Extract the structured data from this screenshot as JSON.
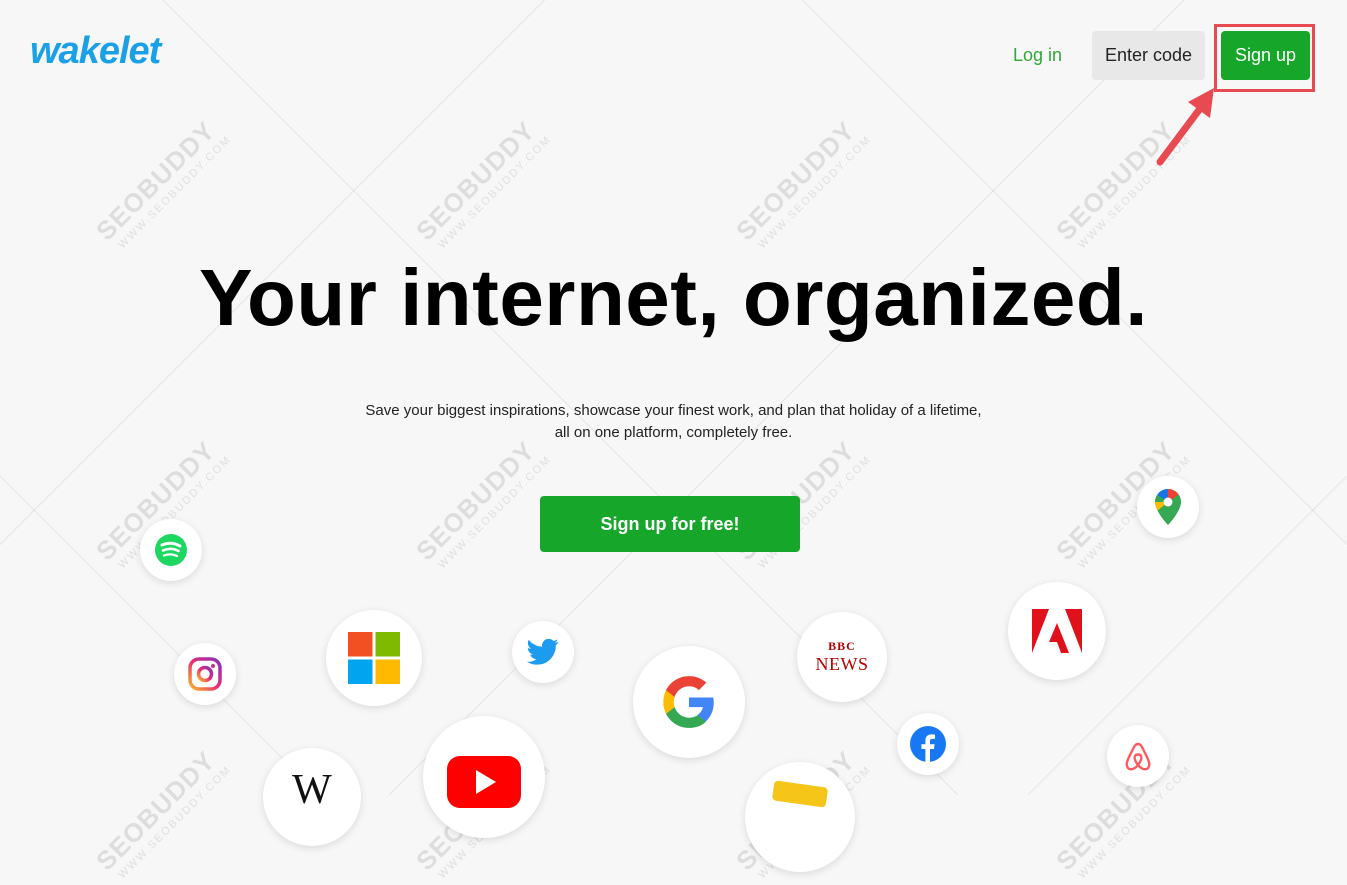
{
  "header": {
    "logo_text": "wakelet",
    "login_label": "Log in",
    "enter_code_label": "Enter code",
    "signup_label": "Sign up"
  },
  "hero": {
    "headline": "Your internet, organized.",
    "subline_1": "Save your biggest inspirations, showcase your finest work, and plan that holiday of a lifetime,",
    "subline_2": "all on one platform, completely free.",
    "cta_label": "Sign up for free!"
  },
  "watermark": {
    "brand": "SEOBUDDY",
    "url": "WWW.SEOBUDDY.COM"
  },
  "logos": [
    {
      "name": "spotify-icon"
    },
    {
      "name": "instagram-icon"
    },
    {
      "name": "microsoft-icon"
    },
    {
      "name": "twitter-icon"
    },
    {
      "name": "google-icon"
    },
    {
      "name": "bbc-news-icon",
      "text_1": "BBC",
      "text_2": "NEWS"
    },
    {
      "name": "facebook-icon"
    },
    {
      "name": "adobe-icon"
    },
    {
      "name": "google-maps-icon"
    },
    {
      "name": "airbnb-icon"
    },
    {
      "name": "wikipedia-icon",
      "text": "W"
    },
    {
      "name": "youtube-icon"
    }
  ],
  "colors": {
    "brand_blue": "#1aa0e6",
    "accent_green": "#16a72a",
    "highlight_red": "#e84a52",
    "background": "#f7f7f7"
  }
}
